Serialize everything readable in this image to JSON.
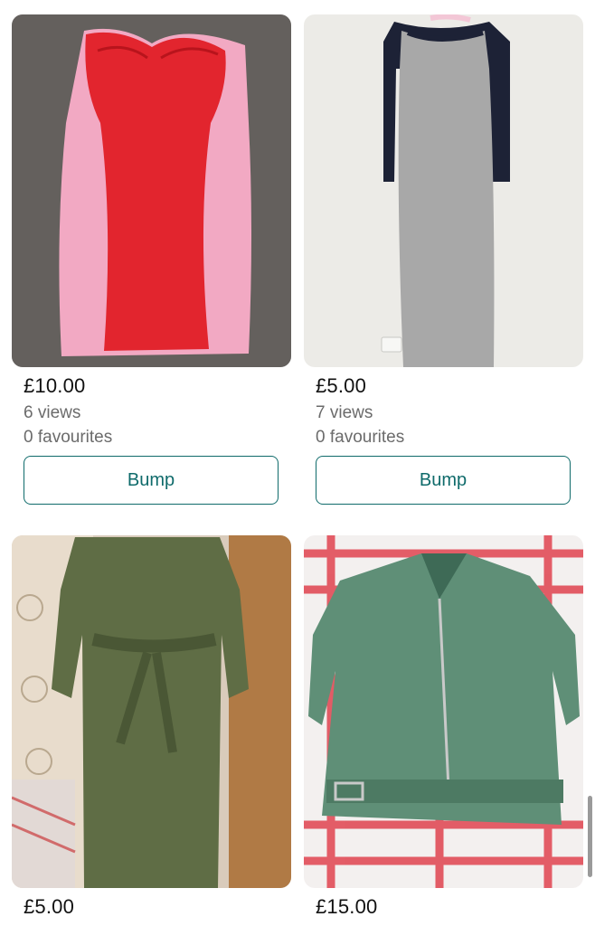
{
  "items": [
    {
      "price": "£10.00",
      "views": "6 views",
      "favourites": "0 favourites",
      "button_label": "Bump",
      "image": "red-pink-bodycon-dress-photo"
    },
    {
      "price": "£5.00",
      "views": "7 views",
      "favourites": "0 favourites",
      "button_label": "Bump",
      "image": "grey-black-raglan-maxi-dress-photo"
    },
    {
      "price": "£5.00",
      "image": "khaki-utility-jumpsuit-photo"
    },
    {
      "price": "£15.00",
      "image": "green-suede-biker-jacket-photo"
    }
  ],
  "colors": {
    "accent": "#0f6b6b",
    "price_text": "#111111",
    "secondary_text": "#6b6b6b"
  }
}
